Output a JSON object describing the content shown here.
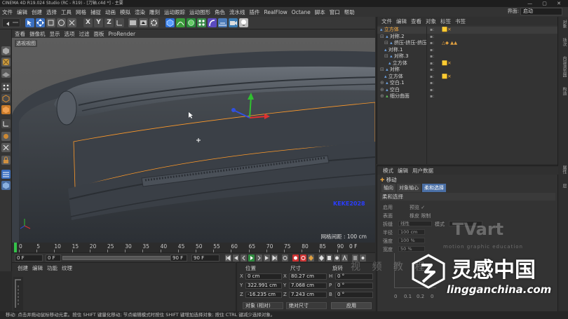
{
  "window": {
    "title": "CINEMA 4D R19.024 Studio (RC - R19) - [刀轴.c4d *] - 主要",
    "controls": "— ▢ ✕"
  },
  "menubar": {
    "items": [
      "文件",
      "编辑",
      "创建",
      "选择",
      "工具",
      "网格",
      "捕捉",
      "动画",
      "模拟",
      "渲染",
      "雕刻",
      "运动跟踪",
      "运动图形",
      "角色",
      "流水线",
      "插件",
      "RealFlow",
      "Octane",
      "脚本",
      "窗口",
      "帮助"
    ],
    "layout_label": "界面:",
    "layout_value": "启动"
  },
  "viewport": {
    "menu": [
      "查看",
      "摄像机",
      "显示",
      "选项",
      "过滤",
      "面板",
      "ProRender"
    ],
    "label": "透视视图",
    "grid_label": "网格间距 : 100 cm",
    "overlay_text": "KEKE2028"
  },
  "object_manager": {
    "menu": [
      "文件",
      "编辑",
      "查看",
      "对象",
      "标签",
      "书签"
    ],
    "rows": [
      {
        "name": "立方体",
        "prefix": "",
        "indent": 0,
        "tags": "🟨✕",
        "selected": true
      },
      {
        "name": "对称.2",
        "prefix": "⊟",
        "indent": 0,
        "tags": "",
        "selected": false
      },
      {
        "name": "挤压-挤压-挤压",
        "prefix": "⊟",
        "indent": 1,
        "tags": "△◆ ▲▲",
        "selected": false
      },
      {
        "name": "对称.1",
        "prefix": "",
        "indent": 1,
        "tags": "",
        "selected": false
      },
      {
        "name": "对称.3",
        "prefix": "⊟",
        "indent": 1,
        "tags": "",
        "selected": false
      },
      {
        "name": "立方体",
        "prefix": "",
        "indent": 2,
        "tags": "🟨✕",
        "selected": false
      },
      {
        "name": "对称",
        "prefix": "⊟",
        "indent": 0,
        "tags": "",
        "selected": false
      },
      {
        "name": "立方体",
        "prefix": "",
        "indent": 1,
        "tags": "🟨✕",
        "selected": false
      },
      {
        "name": "空白.1",
        "prefix": "⊕",
        "indent": 0,
        "tags": "",
        "selected": false
      },
      {
        "name": "空白",
        "prefix": "⊕",
        "indent": 0,
        "tags": "",
        "selected": false
      },
      {
        "name": "细分曲面",
        "prefix": "⊕",
        "indent": 0,
        "tags": "",
        "selected": false
      }
    ]
  },
  "right_strip": [
    "对象",
    "场次",
    "内容浏览器",
    "构造",
    "属性",
    "层"
  ],
  "attributes": {
    "menu": [
      "模式",
      "编辑",
      "用户数据"
    ],
    "title": "移动",
    "tabs": [
      {
        "label": "轴向",
        "active": false
      },
      {
        "label": "对象轴心",
        "active": false
      },
      {
        "label": "柔和选择",
        "active": true
      }
    ],
    "section": "柔和选择",
    "rows": [
      {
        "label": "启用",
        "field": "",
        "extra": "预览 ✓"
      },
      {
        "label": "表面",
        "field": "",
        "extra": "橡皮   限制"
      },
      {
        "label": "拆缝",
        "field": "线性",
        "extra": "模式"
      },
      {
        "label": "半径",
        "field": "100 cm",
        "extra": ""
      },
      {
        "label": "强度",
        "field": "100 %",
        "extra": ""
      },
      {
        "label": "宽度",
        "field": "50 %",
        "extra": ""
      }
    ],
    "graph_ticks": [
      "0",
      "0.1",
      "0.2",
      "0"
    ]
  },
  "timeline": {
    "ticks": [
      "0",
      "5",
      "10",
      "15",
      "20",
      "25",
      "30",
      "35",
      "40",
      "45",
      "50",
      "55",
      "60",
      "65",
      "70",
      "75",
      "80",
      "85",
      "90"
    ],
    "frame_label": "0 F",
    "current_frame": 0
  },
  "transport": {
    "start": "0 F",
    "min": "0 F",
    "max": "90 F",
    "end": "90 F"
  },
  "material_manager": {
    "menu": [
      "创建",
      "编辑",
      "功能",
      "纹理"
    ]
  },
  "coordinates": {
    "headers": {
      "position": "位置",
      "size": "尺寸",
      "rotation": "旋转"
    },
    "rows": [
      {
        "axis": "X",
        "pos": "0 cm",
        "size_axis": "X",
        "size": "80.27 cm",
        "rot_axis": "H",
        "rot": "0 °"
      },
      {
        "axis": "Y",
        "pos": "322.991 cm",
        "size_axis": "Y",
        "size": "7.068 cm",
        "rot_axis": "P",
        "rot": "0 °"
      },
      {
        "axis": "Z",
        "pos": "-16.235 cm",
        "size_axis": "Z",
        "size": "7.243 cm",
        "rot_axis": "B",
        "rot": "0 °"
      }
    ],
    "mode_select": "对象 (相对)",
    "size_select": "绝对尺寸",
    "apply_label": "应用"
  },
  "statusbar": "移动: 点击并拖动鼠标移动元素。按住 SHIFT 键量化移动; 节点编辑模式时按住 SHIFT 键增加选择对象; 按住 CTRL 键减少选择对象。",
  "watermarks": {
    "tvart": "TVart",
    "tvart_sub": "motion graphic education",
    "video": "视 频 教 程",
    "brand_cn": "灵感中国",
    "brand_url": "lingganchina.com"
  },
  "colors": {
    "accent_blue": "#4a6fa5",
    "tag_orange": "#e0a040",
    "playhead_green": "#34c24a",
    "axis_red": "#e03030",
    "axis_green": "#30c030",
    "axis_blue": "#3050e0",
    "selection_orange": "#ff9a2a"
  }
}
